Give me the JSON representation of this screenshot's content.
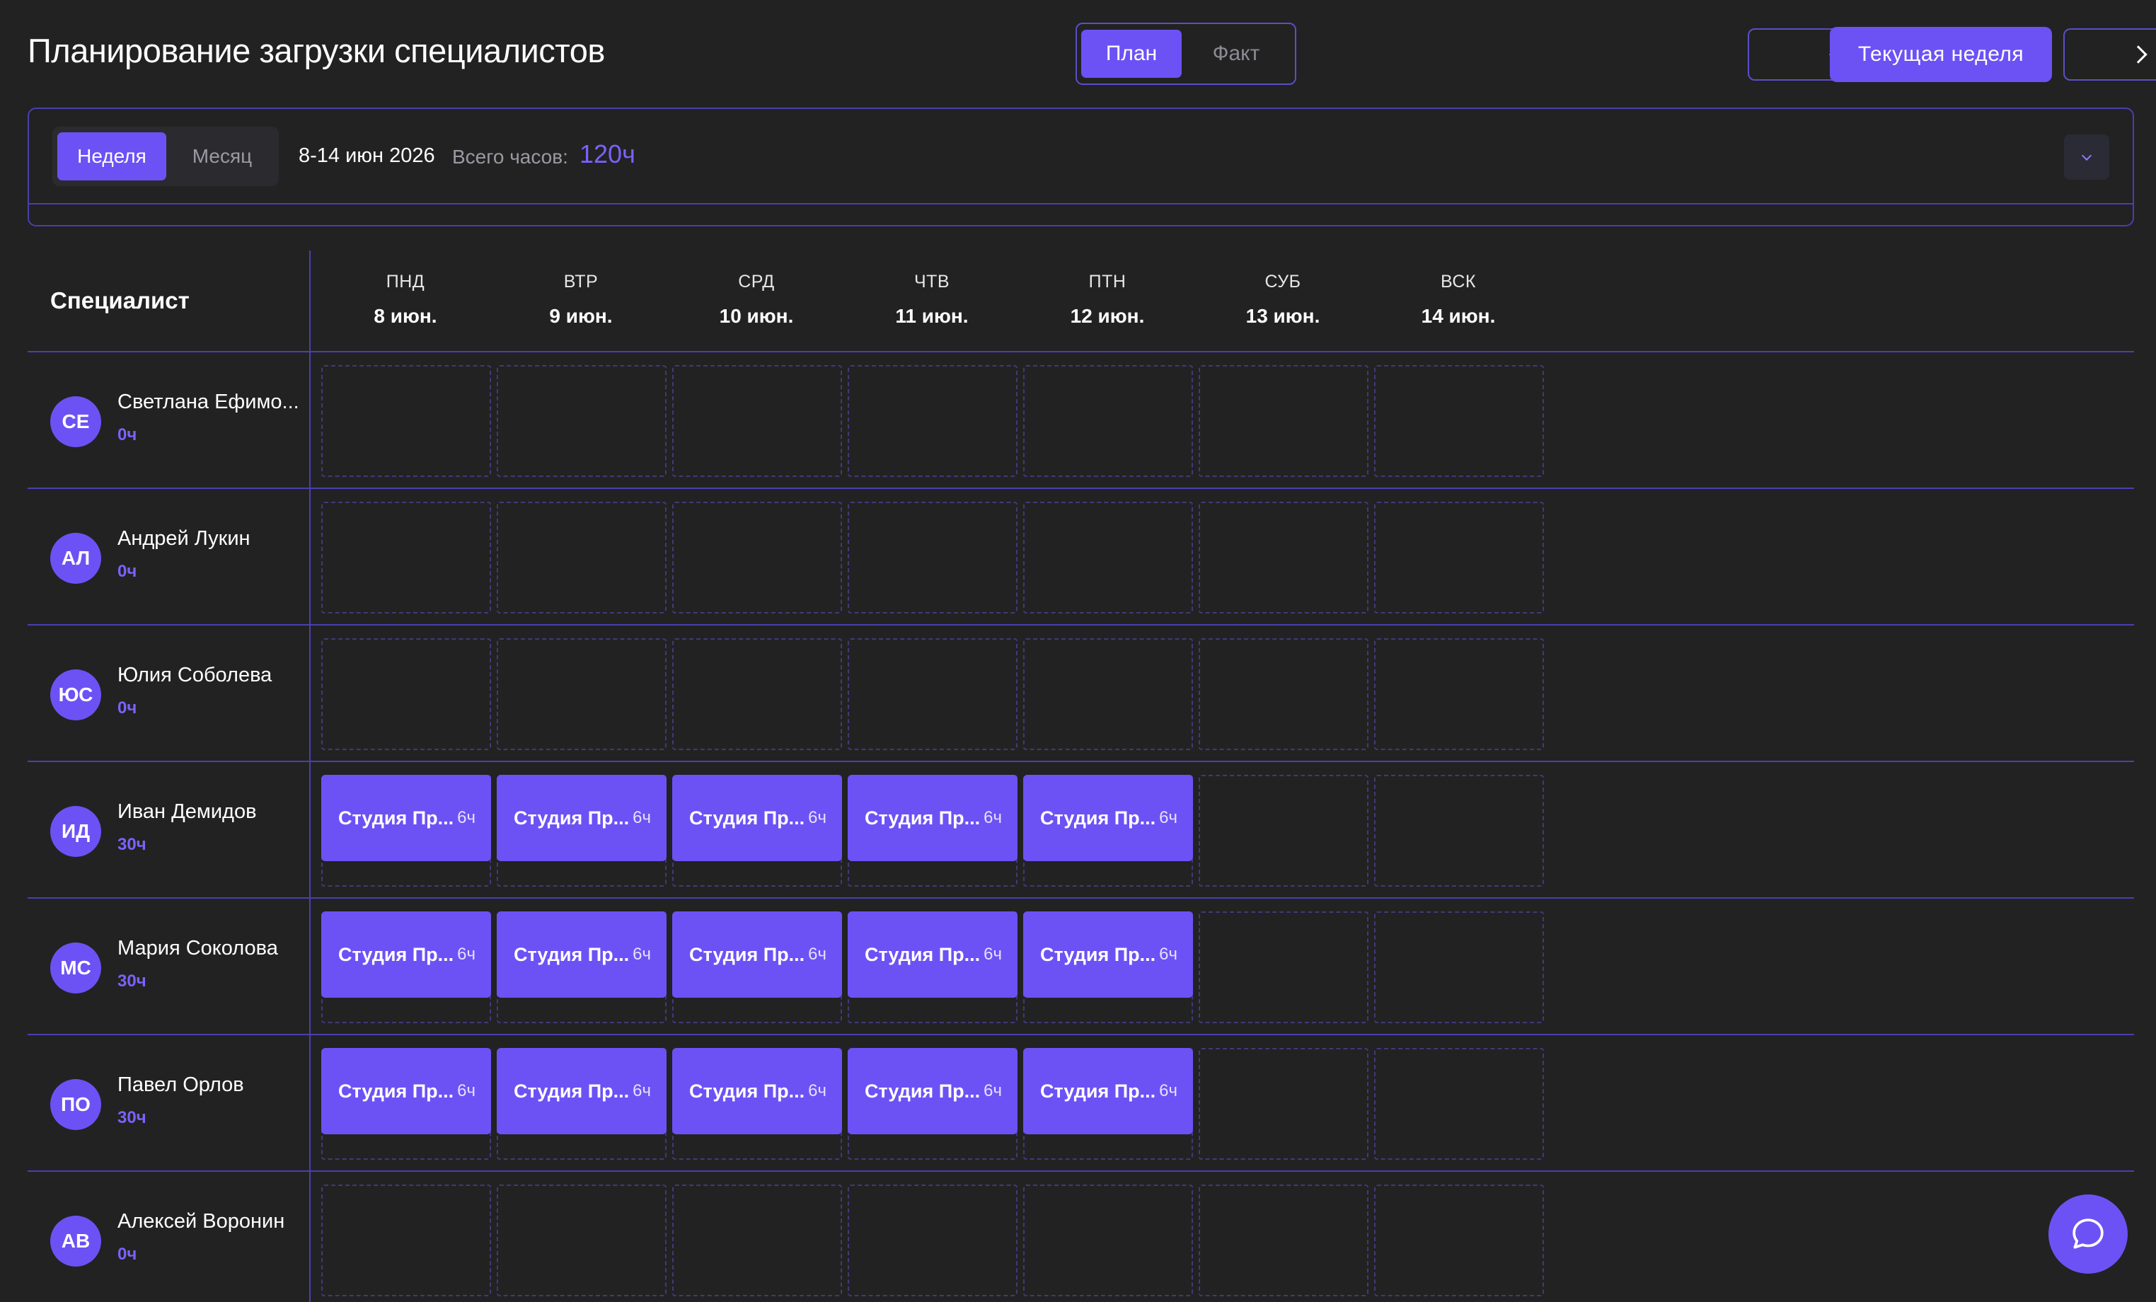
{
  "header": {
    "title": "Планирование загрузки специалистов",
    "mode_toggle": {
      "plan": "План",
      "fact": "Факт",
      "active": "plan"
    },
    "current_week": "Текущая неделя",
    "prev_icon": "chevron-left-icon",
    "next_icon": "chevron-right-icon"
  },
  "filters": {
    "period_toggle": {
      "week": "Неделя",
      "month": "Месяц",
      "active": "week"
    },
    "date_range": "8-14 июн 2026",
    "total_hours_label": "Всего часов:",
    "total_hours_value": "120ч",
    "collapse_icon": "chevron-down-icon"
  },
  "grid": {
    "specialist_header": "Специалист",
    "days": [
      {
        "name": "ПНД",
        "date": "8 июн."
      },
      {
        "name": "ВТР",
        "date": "9 июн."
      },
      {
        "name": "СРД",
        "date": "10 июн."
      },
      {
        "name": "ЧТВ",
        "date": "11 июн."
      },
      {
        "name": "ПТН",
        "date": "12 июн."
      },
      {
        "name": "СУБ",
        "date": "13 июн."
      },
      {
        "name": "ВСК",
        "date": "14 июн."
      }
    ],
    "specialists": [
      {
        "initials": "СЕ",
        "name": "Светлана Ефимо...",
        "hours": "0ч",
        "tasks": []
      },
      {
        "initials": "АЛ",
        "name": "Андрей Лукин",
        "hours": "0ч",
        "tasks": []
      },
      {
        "initials": "ЮС",
        "name": "Юлия Соболева",
        "hours": "0ч",
        "tasks": []
      },
      {
        "initials": "ИД",
        "name": "Иван Демидов",
        "hours": "30ч",
        "tasks": [
          {
            "day": 0,
            "name": "Студия Пр...",
            "hours": "6ч"
          },
          {
            "day": 1,
            "name": "Студия Пр...",
            "hours": "6ч"
          },
          {
            "day": 2,
            "name": "Студия Пр...",
            "hours": "6ч"
          },
          {
            "day": 3,
            "name": "Студия Пр...",
            "hours": "6ч"
          },
          {
            "day": 4,
            "name": "Студия Пр...",
            "hours": "6ч"
          }
        ]
      },
      {
        "initials": "МС",
        "name": "Мария Соколова",
        "hours": "30ч",
        "tasks": [
          {
            "day": 0,
            "name": "Студия Пр...",
            "hours": "6ч"
          },
          {
            "day": 1,
            "name": "Студия Пр...",
            "hours": "6ч"
          },
          {
            "day": 2,
            "name": "Студия Пр...",
            "hours": "6ч"
          },
          {
            "day": 3,
            "name": "Студия Пр...",
            "hours": "6ч"
          },
          {
            "day": 4,
            "name": "Студия Пр...",
            "hours": "6ч"
          }
        ]
      },
      {
        "initials": "ПО",
        "name": "Павел Орлов",
        "hours": "30ч",
        "tasks": [
          {
            "day": 0,
            "name": "Студия Пр...",
            "hours": "6ч"
          },
          {
            "day": 1,
            "name": "Студия Пр...",
            "hours": "6ч"
          },
          {
            "day": 2,
            "name": "Студия Пр...",
            "hours": "6ч"
          },
          {
            "day": 3,
            "name": "Студия Пр...",
            "hours": "6ч"
          },
          {
            "day": 4,
            "name": "Студия Пр...",
            "hours": "6ч"
          }
        ]
      },
      {
        "initials": "АВ",
        "name": "Алексей Воронин",
        "hours": "0ч",
        "tasks": []
      }
    ]
  },
  "chat": {
    "icon": "chat-bubble-icon"
  },
  "colors": {
    "accent": "#6c52f5",
    "accent_text": "#7b61ff",
    "border": "#4a3fb0",
    "background": "#222222"
  }
}
